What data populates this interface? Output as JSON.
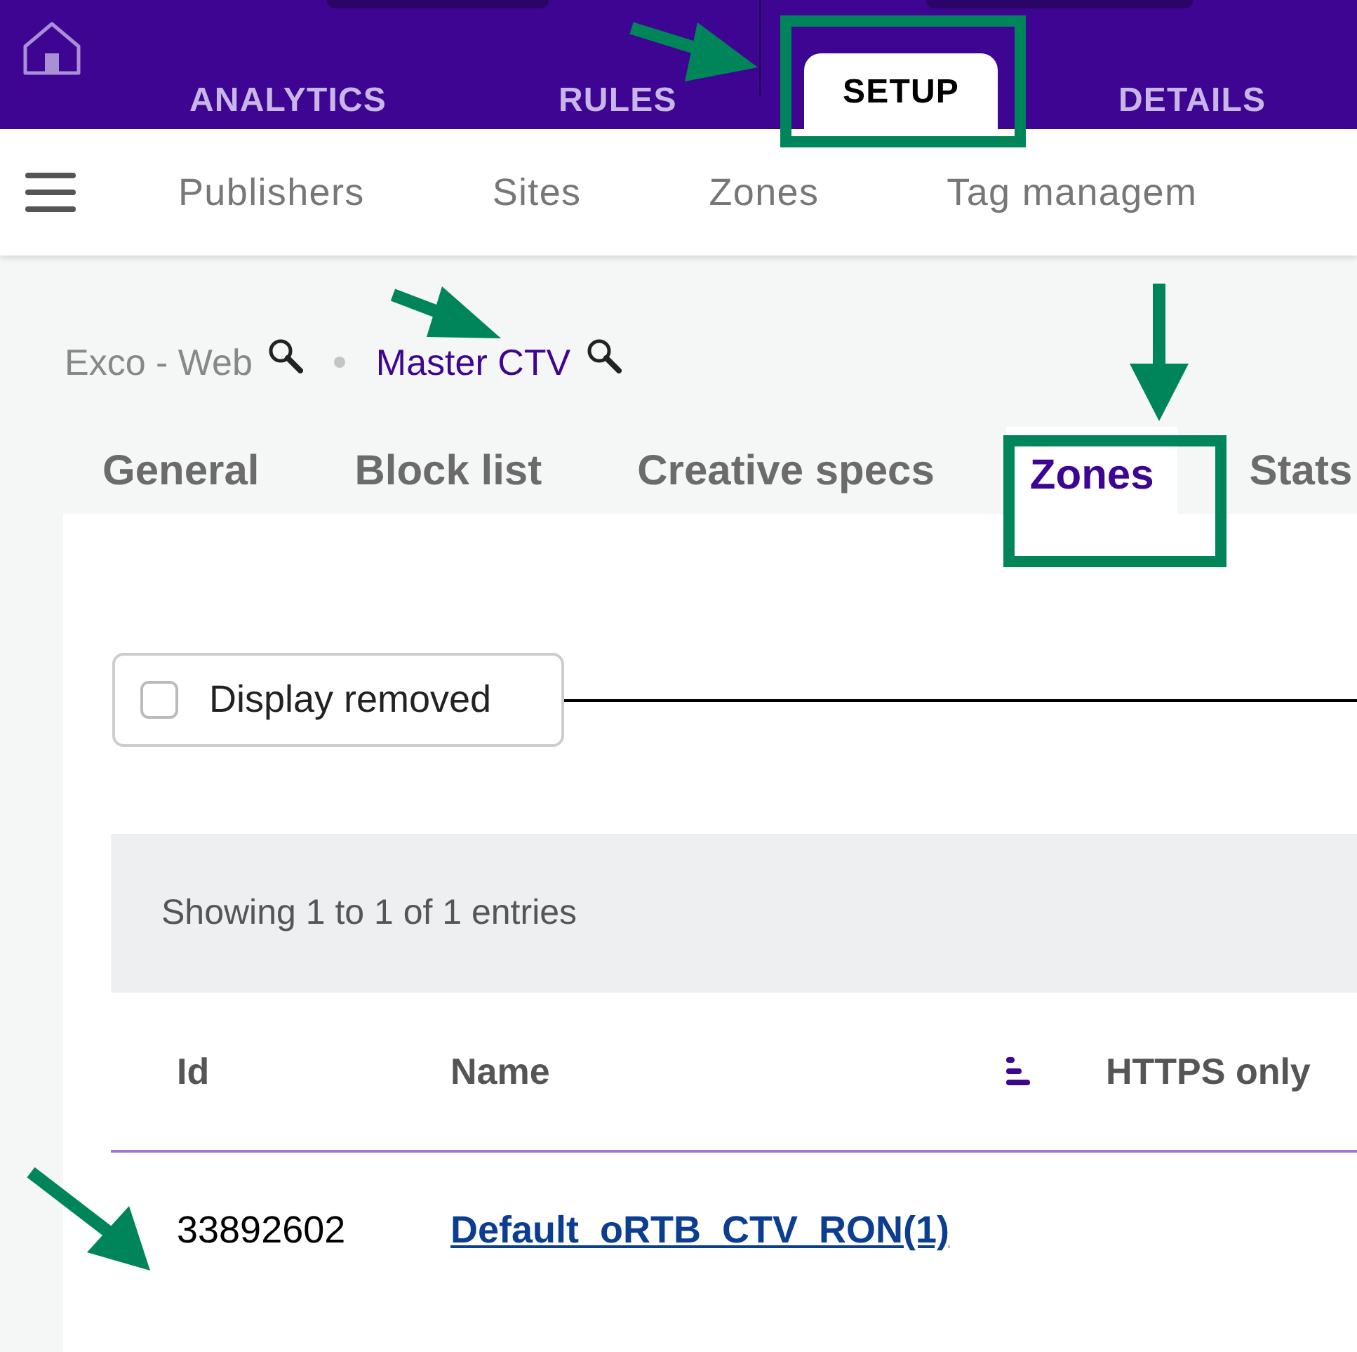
{
  "top_nav": {
    "tabs": [
      {
        "label": "ANALYTICS",
        "selected": false
      },
      {
        "label": "RULES",
        "selected": false
      },
      {
        "label": "SETUP",
        "selected": true
      },
      {
        "label": "DETAILS",
        "selected": false
      }
    ]
  },
  "sub_nav": {
    "items": [
      {
        "label": "Publishers"
      },
      {
        "label": "Sites"
      },
      {
        "label": "Zones"
      },
      {
        "label": "Tag managem"
      }
    ]
  },
  "breadcrumb": [
    {
      "label": "Exco - Web",
      "current": false
    },
    {
      "label": "Master CTV",
      "current": true
    }
  ],
  "tabs": [
    {
      "label": "General",
      "selected": false
    },
    {
      "label": "Block list",
      "selected": false
    },
    {
      "label": "Creative specs",
      "selected": false
    },
    {
      "label": "Zones",
      "selected": true
    },
    {
      "label": "Stats",
      "selected": false
    }
  ],
  "filter": {
    "label": "Display removed",
    "checked": false
  },
  "table": {
    "info": "Showing 1 to 1 of 1 entries",
    "columns": [
      "Id",
      "Name",
      "HTTPS only"
    ],
    "rows": [
      {
        "id": "33892602",
        "name": "Default_oRTB_CTV_RON(1)"
      }
    ]
  }
}
